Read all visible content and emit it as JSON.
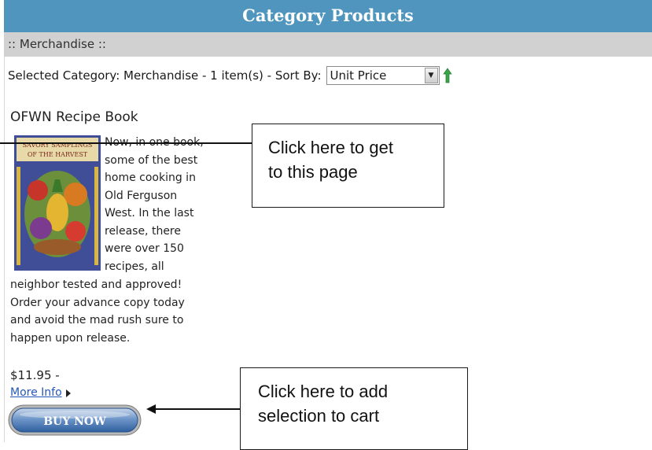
{
  "header": {
    "title": "Category Products"
  },
  "breadcrumb": {
    "text": ":: Merchandise ::"
  },
  "sort_row": {
    "text": "Selected Category: Merchandise - 1 item(s) - Sort By:",
    "sort_selected": "Unit Price"
  },
  "product": {
    "title": "OFWN Recipe Book",
    "cover_text_line1": "SAVORY SAMPLINGS",
    "cover_text_line2": "OF THE HARVEST",
    "desc_right": [
      "Now, in one book,",
      "some of the best",
      "home cooking in",
      "Old Ferguson",
      "West. In the last",
      "release, there",
      "were over 150",
      "recipes, all"
    ],
    "desc_full": [
      "neighbor tested and approved!",
      "Order your advance copy today",
      "and avoid the mad rush sure to",
      "happen upon release."
    ],
    "price": "$11.95 -",
    "more_info": "More Info",
    "buy_now": "BUY NOW"
  },
  "callouts": {
    "page": [
      "Click here to get",
      "to this page"
    ],
    "cart": [
      "Click here to add",
      "selection to cart"
    ]
  },
  "icons": {
    "dropdown": "chevron-down-icon",
    "sort_direction": "sort-ascending-arrow-icon",
    "more_info_arrow": "play-arrow-icon"
  },
  "colors": {
    "header_bg": "#4f95bd",
    "subheader_bg": "#d1d1d1",
    "link": "#2457b8",
    "buy_button": "#3f74b0",
    "sort_arrow": "#3aa548"
  }
}
